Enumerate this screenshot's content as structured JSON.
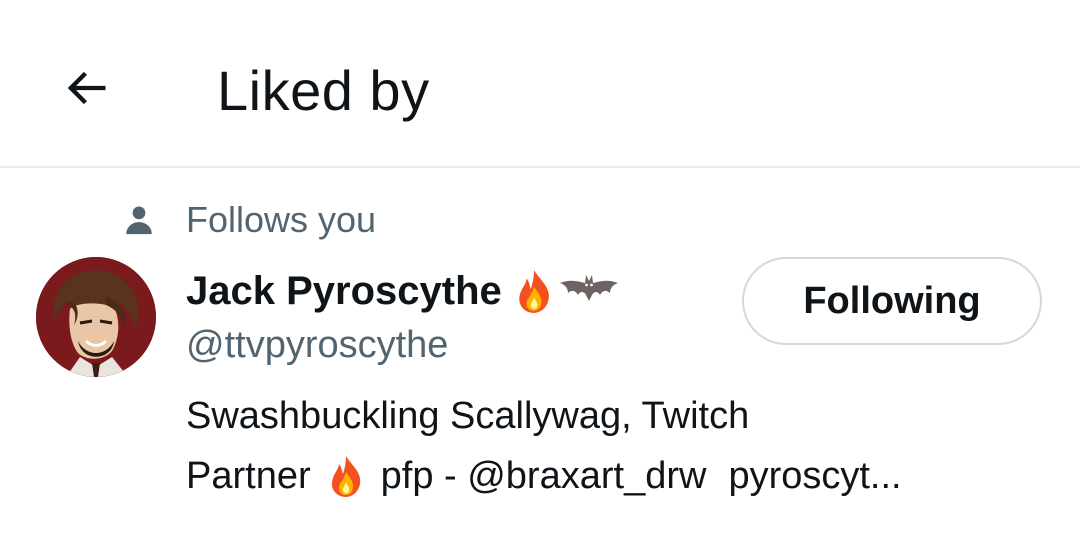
{
  "header": {
    "back_icon": "arrow-left-icon",
    "title": "Liked by"
  },
  "user": {
    "follows_you_icon": "person-icon",
    "follows_you_label": "Follows you",
    "avatar_icon": "avatar",
    "display_name": "Jack Pyroscythe",
    "name_emojis": [
      "fire-icon",
      "bat-icon"
    ],
    "handle": "@ttvpyroscythe",
    "follow_button_label": "Following",
    "bio": {
      "line1": "Swashbuckling Scallywag, Twitch",
      "line2_part1": "Partner",
      "line2_emoji": "fire-icon",
      "line2_part2": "pfp - @braxart_drw",
      "line2_part3": "pyroscyt..."
    }
  },
  "colors": {
    "primary_text": "#0f1419",
    "secondary_text": "#536471",
    "divider": "#e6ecf0",
    "button_border": "#cfd9de"
  }
}
